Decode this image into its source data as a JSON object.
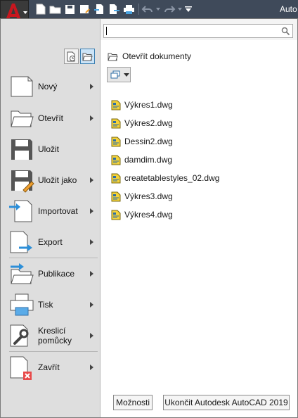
{
  "title": "Auto",
  "search": {
    "value": ""
  },
  "menu_items": [
    {
      "label": "Nový",
      "icon": "new-document-icon",
      "has_submenu": true
    },
    {
      "label": "Otevřít",
      "icon": "open-folder-icon",
      "has_submenu": true
    },
    {
      "label": "Uložit",
      "icon": "save-icon",
      "has_submenu": false
    },
    {
      "label": "Uložit jako",
      "icon": "save-as-icon",
      "has_submenu": true
    },
    {
      "label": "Importovat",
      "icon": "import-icon",
      "has_submenu": true
    },
    {
      "label": "Export",
      "icon": "export-icon",
      "has_submenu": true
    },
    {
      "label": "Publikace",
      "icon": "publish-icon",
      "has_submenu": true
    },
    {
      "label": "Tisk",
      "icon": "print-icon",
      "has_submenu": true
    },
    {
      "label_line1": "Kreslicí",
      "label_line2": "pomůcky",
      "icon": "wrench-icon",
      "has_submenu": true
    },
    {
      "label": "Zavřít",
      "icon": "close-document-icon",
      "has_submenu": true
    }
  ],
  "recent": {
    "heading": "Otevřít dokumenty",
    "documents": [
      "Výkres1.dwg",
      "Výkres2.dwg",
      "Dessin2.dwg",
      "damdim.dwg",
      "createtablestyles_02.dwg",
      "Výkres3.dwg",
      "Výkres4.dwg"
    ]
  },
  "footer": {
    "options_label": "Možnosti",
    "exit_label": "Ukončit Autodesk AutoCAD 2019"
  },
  "colors": {
    "accent": "#c00000",
    "titlebar": "#3f4a5a",
    "selection": "#cce4f7"
  }
}
